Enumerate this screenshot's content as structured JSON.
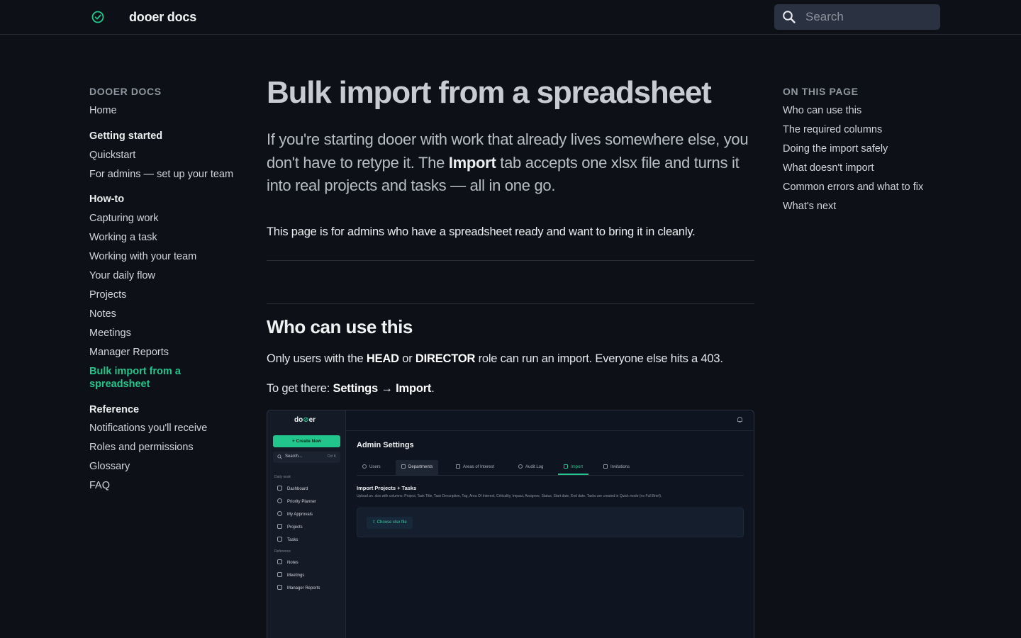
{
  "header": {
    "brand": "dooer docs",
    "search_placeholder": "Search"
  },
  "sidebar": {
    "title": "DOOER DOCS",
    "home": "Home",
    "sections": [
      {
        "label": "Getting started",
        "items": [
          "Quickstart",
          "For admins — set up your team"
        ]
      },
      {
        "label": "How-to",
        "items": [
          "Capturing work",
          "Working a task",
          "Working with your team",
          "Your daily flow",
          "Projects",
          "Notes",
          "Meetings",
          "Manager Reports",
          "Bulk import from a spreadsheet"
        ]
      },
      {
        "label": "Reference",
        "items": [
          "Notifications you'll receive",
          "Roles and permissions",
          "Glossary",
          "FAQ"
        ]
      }
    ],
    "active_item": "Bulk import from a spreadsheet"
  },
  "toc": {
    "title": "ON THIS PAGE",
    "items": [
      "Who can use this",
      "The required columns",
      "Doing the import safely",
      "What doesn't import",
      "Common errors and what to fix",
      "What's next"
    ]
  },
  "article": {
    "title": "Bulk import from a spreadsheet",
    "lead_1": "If you're starting dooer with work that already lives somewhere else, you don't have to retype it. The ",
    "lead_bold": "Import",
    "lead_2": " tab accepts one xlsx file and turns it into real projects and tasks — all in one go.",
    "note": "This page is for admins who have a spreadsheet ready and want to bring it in cleanly.",
    "section_title": "Who can use this",
    "p1_a": "Only users with the ",
    "p1_head": "HEAD",
    "p1_b": " or ",
    "p1_director": "DIRECTOR",
    "p1_c": " role can run an import. Everyone else hits a 403.",
    "p2_a": "To get there: ",
    "p2_settings": "Settings",
    "p2_arrow": " → ",
    "p2_import": "Import",
    "p2_end": "."
  },
  "screenshot": {
    "logo_a": "do",
    "logo_o": "⊘",
    "logo_b": "er",
    "create_new": "+ Create New",
    "search": "Search...",
    "search_kbd": "Ctrl K",
    "group_daily": "Daily work",
    "nav_daily": [
      "Dashboard",
      "Priority Planner",
      "My Approvals",
      "Projects",
      "Tasks"
    ],
    "group_reference": "Reference",
    "nav_reference": [
      "Notes",
      "Meetings",
      "Manager Reports"
    ],
    "page_title": "Admin Settings",
    "tabs": [
      "Users",
      "Departments",
      "Areas of Interest",
      "Audit Log",
      "Import",
      "Invitations"
    ],
    "selected_tab": "Departments",
    "active_tab": "Import",
    "section_title": "Import Projects + Tasks",
    "section_desc": "Upload an .xlsx with columns: Project, Task Title, Task Description, Tag, Area Of Interest, Criticality, Impact, Assignee, Status, Start date, End date. Tasks are created in Quick mode (no Full Brief).",
    "choose_button": "Choose xlsx file"
  },
  "colors": {
    "background": "#0d1117",
    "accent": "#22c58b",
    "search_bg": "#2a3140"
  }
}
